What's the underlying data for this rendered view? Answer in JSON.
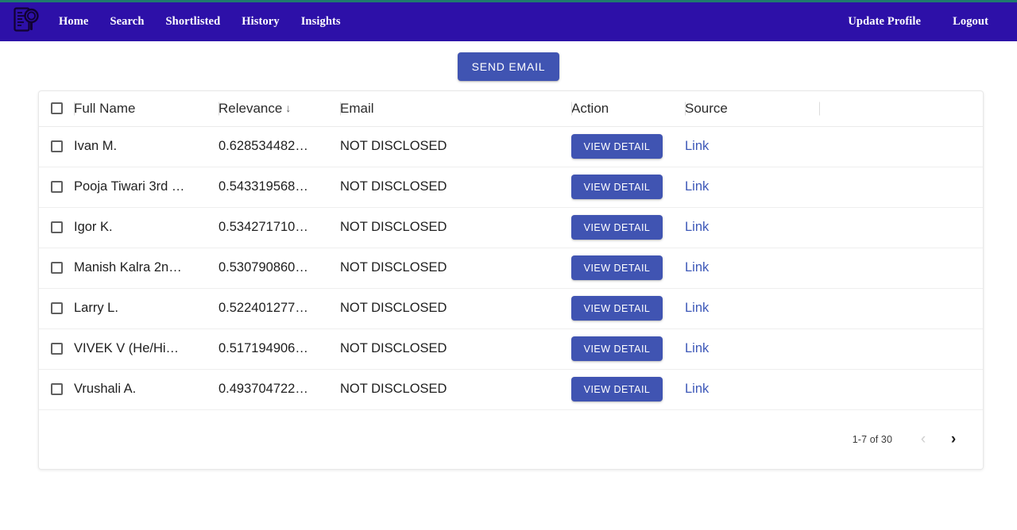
{
  "theme": {
    "navbar_bg": "#2d10a8",
    "top_strip": "#1f7a6e",
    "primary_button": "#4054b2",
    "link_color": "#3d58b8"
  },
  "navbar": {
    "logo_icon": "document-magnifier-icon",
    "links": [
      {
        "label": "Home"
      },
      {
        "label": "Search"
      },
      {
        "label": "Shortlisted"
      },
      {
        "label": "History"
      },
      {
        "label": "Insights"
      }
    ],
    "right_links": [
      {
        "label": "Update Profile"
      },
      {
        "label": "Logout"
      }
    ]
  },
  "toolbar": {
    "send_email_label": "SEND EMAIL"
  },
  "table": {
    "columns": [
      {
        "key": "select",
        "label": ""
      },
      {
        "key": "full_name",
        "label": "Full Name"
      },
      {
        "key": "relevance",
        "label": "Relevance",
        "sort": "desc",
        "sort_glyph": "↓"
      },
      {
        "key": "email",
        "label": "Email"
      },
      {
        "key": "action",
        "label": "Action"
      },
      {
        "key": "source",
        "label": "Source"
      },
      {
        "key": "spacer",
        "label": ""
      }
    ],
    "rows": [
      {
        "full_name": "Ivan M.",
        "relevance": "0.628534482…",
        "email": "NOT DISCLOSED",
        "action": "VIEW DETAIL",
        "source": "Link",
        "checked": false
      },
      {
        "full_name": "Pooja Tiwari 3rd …",
        "relevance": "0.543319568…",
        "email": "NOT DISCLOSED",
        "action": "VIEW DETAIL",
        "source": "Link",
        "checked": false
      },
      {
        "full_name": "Igor K.",
        "relevance": "0.534271710…",
        "email": "NOT DISCLOSED",
        "action": "VIEW DETAIL",
        "source": "Link",
        "checked": false
      },
      {
        "full_name": "Manish Kalra 2n…",
        "relevance": "0.530790860…",
        "email": "NOT DISCLOSED",
        "action": "VIEW DETAIL",
        "source": "Link",
        "checked": false
      },
      {
        "full_name": "Larry L.",
        "relevance": "0.522401277…",
        "email": "NOT DISCLOSED",
        "action": "VIEW DETAIL",
        "source": "Link",
        "checked": false
      },
      {
        "full_name": "VIVEK V (He/Hi…",
        "relevance": "0.517194906…",
        "email": "NOT DISCLOSED",
        "action": "VIEW DETAIL",
        "source": "Link",
        "checked": false
      },
      {
        "full_name": "Vrushali A.",
        "relevance": "0.493704722…",
        "email": "NOT DISCLOSED",
        "action": "VIEW DETAIL",
        "source": "Link",
        "checked": false
      }
    ]
  },
  "pagination": {
    "range_label": "1-7 of 30",
    "prev_glyph": "‹",
    "next_glyph": "›",
    "prev_enabled": false,
    "next_enabled": true
  }
}
